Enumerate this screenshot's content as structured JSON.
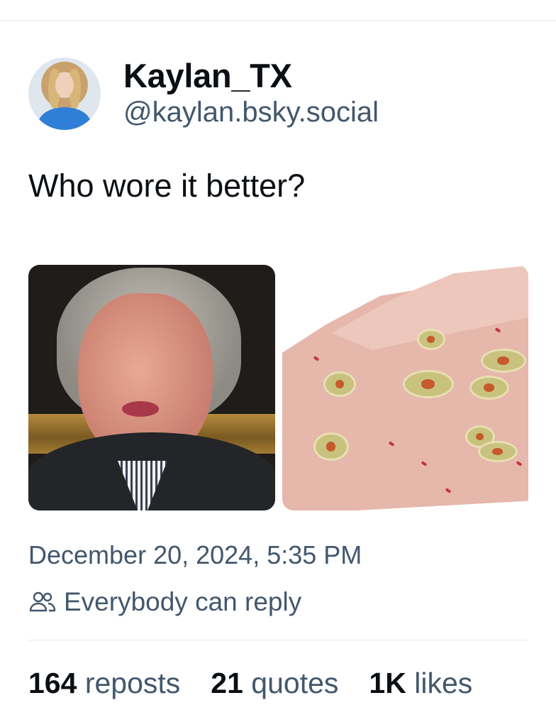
{
  "author": {
    "display_name": "Kaylan_TX",
    "handle": "@kaylan.bsky.social"
  },
  "post": {
    "text": "Who wore it better?",
    "timestamp": "December 20, 2024, 5:35 PM",
    "reply_setting": "Everybody can reply"
  },
  "stats": {
    "reposts_count": "164",
    "reposts_label": "reposts",
    "quotes_count": "21",
    "quotes_label": "quotes",
    "likes_count": "1K",
    "likes_label": "likes"
  },
  "icons": {
    "reply_setting": "people-icon"
  },
  "colors": {
    "text_primary": "#0b0f14",
    "text_secondary": "#42576c",
    "divider": "#e6e9ec"
  }
}
